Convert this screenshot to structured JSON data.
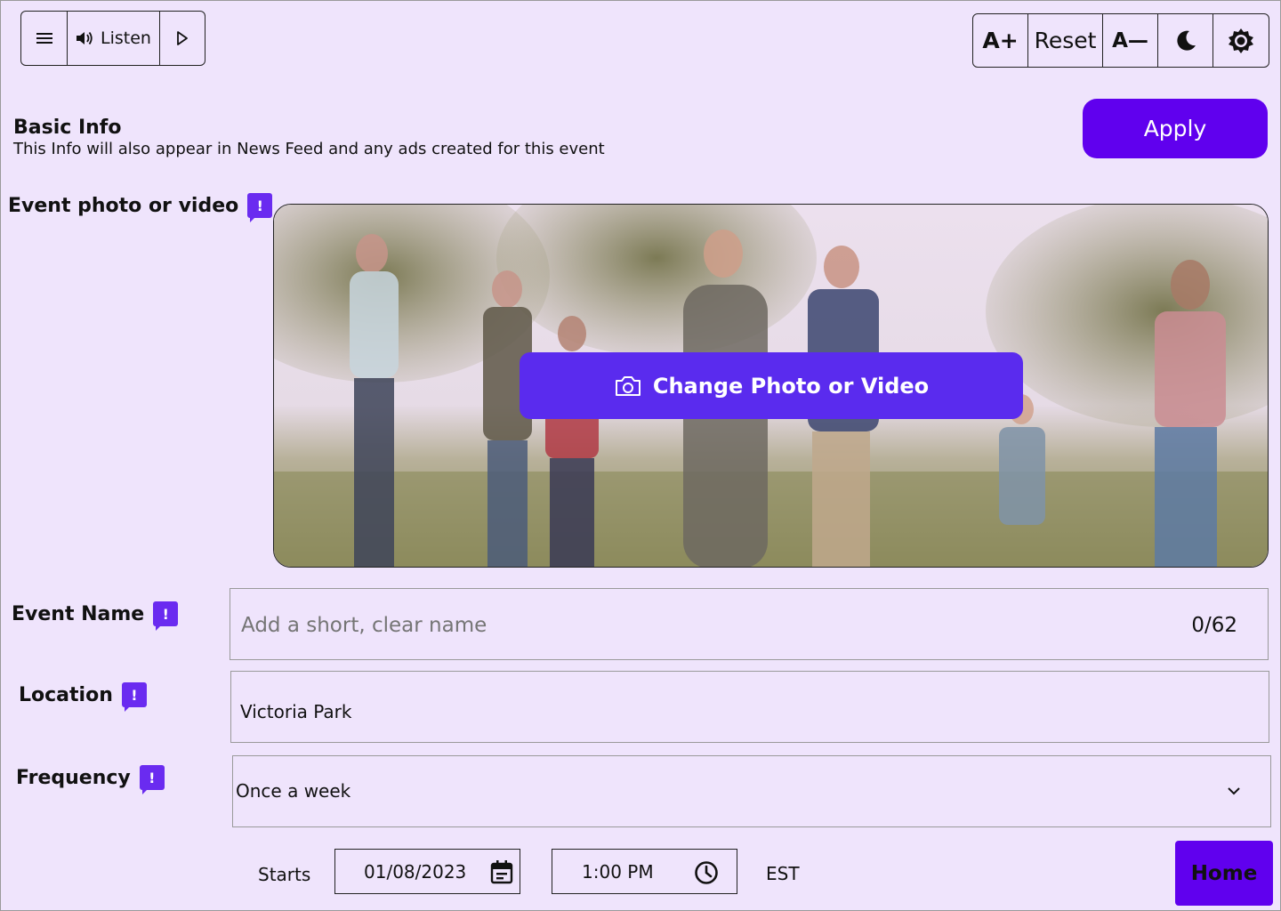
{
  "toolbar": {
    "menu_icon": "hamburger-icon",
    "listen_label": "Listen",
    "speaker_icon": "speaker-icon",
    "play_icon": "play-icon"
  },
  "accessibility": {
    "increase_label": "A+",
    "reset_label": "Reset",
    "decrease_label": "A—",
    "dark_mode_icon": "moon-icon",
    "light_mode_icon": "sun-icon"
  },
  "apply_label": "Apply",
  "basic_info": {
    "title": "Basic Info",
    "subtitle": "This Info will also appear in News Feed and any ads created for this event"
  },
  "event_photo": {
    "label": "Event photo or video",
    "change_button": "Change Photo or Video",
    "camera_icon": "camera-icon"
  },
  "event_name": {
    "label": "Event Name",
    "placeholder": "Add a short, clear name",
    "value": "",
    "counter": "0/62"
  },
  "location": {
    "label": "Location",
    "value": "Victoria Park"
  },
  "frequency": {
    "label": "Frequency",
    "value": "Once a week"
  },
  "starts": {
    "label": "Starts",
    "date": "01/08/2023",
    "time": "1:00 PM",
    "timezone": "EST"
  },
  "home_label": "Home",
  "colors": {
    "background": "#efe4fc",
    "accent": "#6000ee",
    "badge": "#6a2bf0",
    "photo_button": "#5a2bee"
  }
}
